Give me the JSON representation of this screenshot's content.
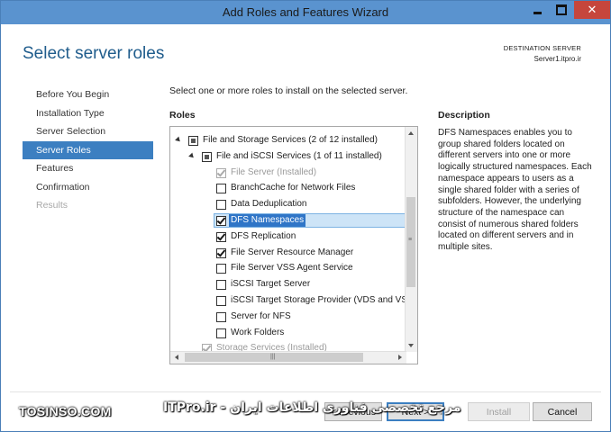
{
  "window": {
    "title": "Add Roles and Features Wizard"
  },
  "header": {
    "title": "Select server roles",
    "destination_label": "DESTINATION SERVER",
    "destination_server": "Server1.itpro.ir"
  },
  "nav": {
    "items": [
      {
        "label": "Before You Begin",
        "state": "normal"
      },
      {
        "label": "Installation Type",
        "state": "normal"
      },
      {
        "label": "Server Selection",
        "state": "normal"
      },
      {
        "label": "Server Roles",
        "state": "active"
      },
      {
        "label": "Features",
        "state": "normal"
      },
      {
        "label": "Confirmation",
        "state": "normal"
      },
      {
        "label": "Results",
        "state": "disabled"
      }
    ]
  },
  "main": {
    "instruction": "Select one or more roles to install on the selected server.",
    "roles_heading": "Roles",
    "roles": [
      {
        "label": "File and Storage Services (2 of 12 installed)",
        "level": 0,
        "expander": true,
        "check": "partial"
      },
      {
        "label": "File and iSCSI Services (1 of 11 installed)",
        "level": 1,
        "expander": true,
        "check": "partial"
      },
      {
        "label": "File Server (Installed)",
        "level": 2,
        "check": "greyed-checked"
      },
      {
        "label": "BranchCache for Network Files",
        "level": 2,
        "check": "unchecked"
      },
      {
        "label": "Data Deduplication",
        "level": 2,
        "check": "unchecked"
      },
      {
        "label": "DFS Namespaces",
        "level": 2,
        "check": "checked",
        "selected": true
      },
      {
        "label": "DFS Replication",
        "level": 2,
        "check": "checked"
      },
      {
        "label": "File Server Resource Manager",
        "level": 2,
        "check": "checked"
      },
      {
        "label": "File Server VSS Agent Service",
        "level": 2,
        "check": "unchecked"
      },
      {
        "label": "iSCSI Target Server",
        "level": 2,
        "check": "unchecked"
      },
      {
        "label": "iSCSI Target Storage Provider (VDS and VSS",
        "level": 2,
        "check": "unchecked"
      },
      {
        "label": "Server for NFS",
        "level": 2,
        "check": "unchecked"
      },
      {
        "label": "Work Folders",
        "level": 2,
        "check": "unchecked"
      },
      {
        "label": "Storage Services (Installed)",
        "level": 1,
        "check": "greyed-checked"
      }
    ],
    "description_heading": "Description",
    "description_text": "DFS Namespaces enables you to group shared folders located on different servers into one or more logically structured namespaces. Each namespace appears to users as a single shared folder with a series of subfolders. However, the underlying structure of the namespace can consist of numerous shared folders located on different servers and in multiple sites."
  },
  "footer": {
    "previous_label": "< Previous",
    "next_label": "Next >",
    "install_label": "Install",
    "cancel_label": "Cancel"
  },
  "watermarks": {
    "left": "TOSINSO.COM",
    "middle": "مرجع تخصصی فناوری اطلاعات ایران - ITPro.ir"
  }
}
